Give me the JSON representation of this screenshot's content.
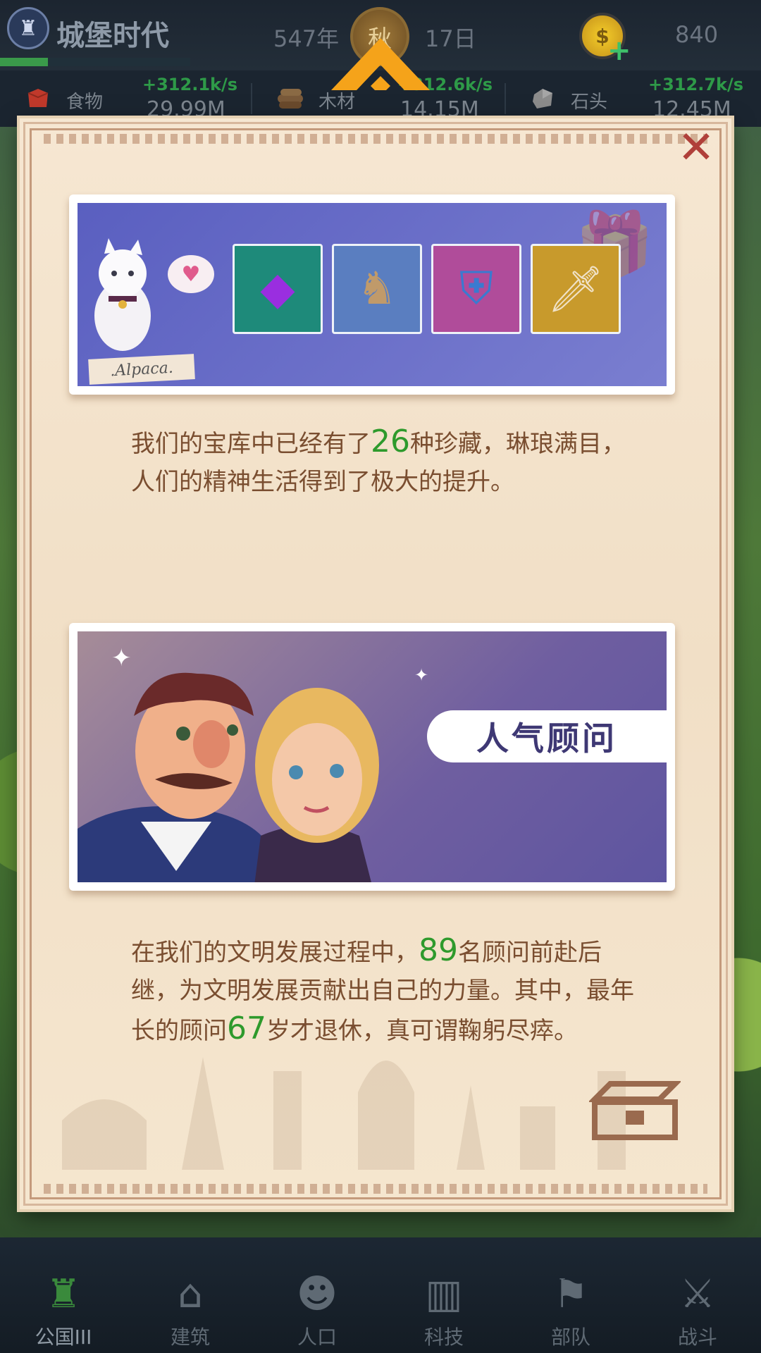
{
  "header": {
    "city_name": "城堡时代",
    "year": "547年",
    "season": "秋",
    "day": "17日",
    "coins": "840",
    "city_progress": 0.25
  },
  "resources": [
    {
      "name": "食物",
      "rate": "+312.1k/s",
      "amount": "29.99M",
      "icon": "food-icon"
    },
    {
      "name": "木材",
      "rate": "+312.6k/s",
      "amount": "14.15M",
      "icon": "wood-icon"
    },
    {
      "name": "石头",
      "rate": "+312.7k/s",
      "amount": "12.45M",
      "icon": "stone-icon"
    }
  ],
  "dialog": {
    "alpaca_tag": ".Alpaca.",
    "treasure_text": {
      "pre": "我们的宝库中已经有了",
      "count": "26",
      "post": "种珍藏，琳琅满目，人们的精神生活得到了极大的提升。"
    },
    "advisor_title": "人气顾问",
    "advisor_text": {
      "pre": "在我们的文明发展过程中，",
      "count": "89",
      "mid": "名顾问前赴后继，为文明发展贡献出自己的力量。其中，最年长的顾问",
      "age": "67",
      "post": "岁才退休，真可谓鞠躬尽瘁。"
    },
    "items": [
      {
        "name": "purple-crystal-icon",
        "glyph": "◆",
        "bg": "#1e8a7a",
        "fg": "#9a2ee0"
      },
      {
        "name": "statue-icon",
        "glyph": "♞",
        "bg": "#5a7ec0",
        "fg": "#c09a6a"
      },
      {
        "name": "shield-sword-icon",
        "glyph": "⛨",
        "bg": "#b04c9a",
        "fg": "#3a7ad0"
      },
      {
        "name": "dagger-icon",
        "glyph": "🗡",
        "bg": "#c89a2c",
        "fg": "#f0e2c8"
      }
    ]
  },
  "nav": [
    {
      "label": "公国III",
      "icon": "castle-icon",
      "glyph": "♜",
      "active": true
    },
    {
      "label": "建筑",
      "icon": "house-icon",
      "glyph": "⌂",
      "active": false
    },
    {
      "label": "人口",
      "icon": "person-icon",
      "glyph": "☻",
      "active": false
    },
    {
      "label": "科技",
      "icon": "book-icon",
      "glyph": "📖",
      "active": false
    },
    {
      "label": "部队",
      "icon": "banner-icon",
      "glyph": "⚑",
      "active": false
    },
    {
      "label": "战斗",
      "icon": "crossed-swords-icon",
      "glyph": "⚔",
      "active": false
    }
  ],
  "colors": {
    "accent_orange": "#f5a31a",
    "number_green": "#2e9a2c",
    "text_brown": "#7a4e30"
  }
}
